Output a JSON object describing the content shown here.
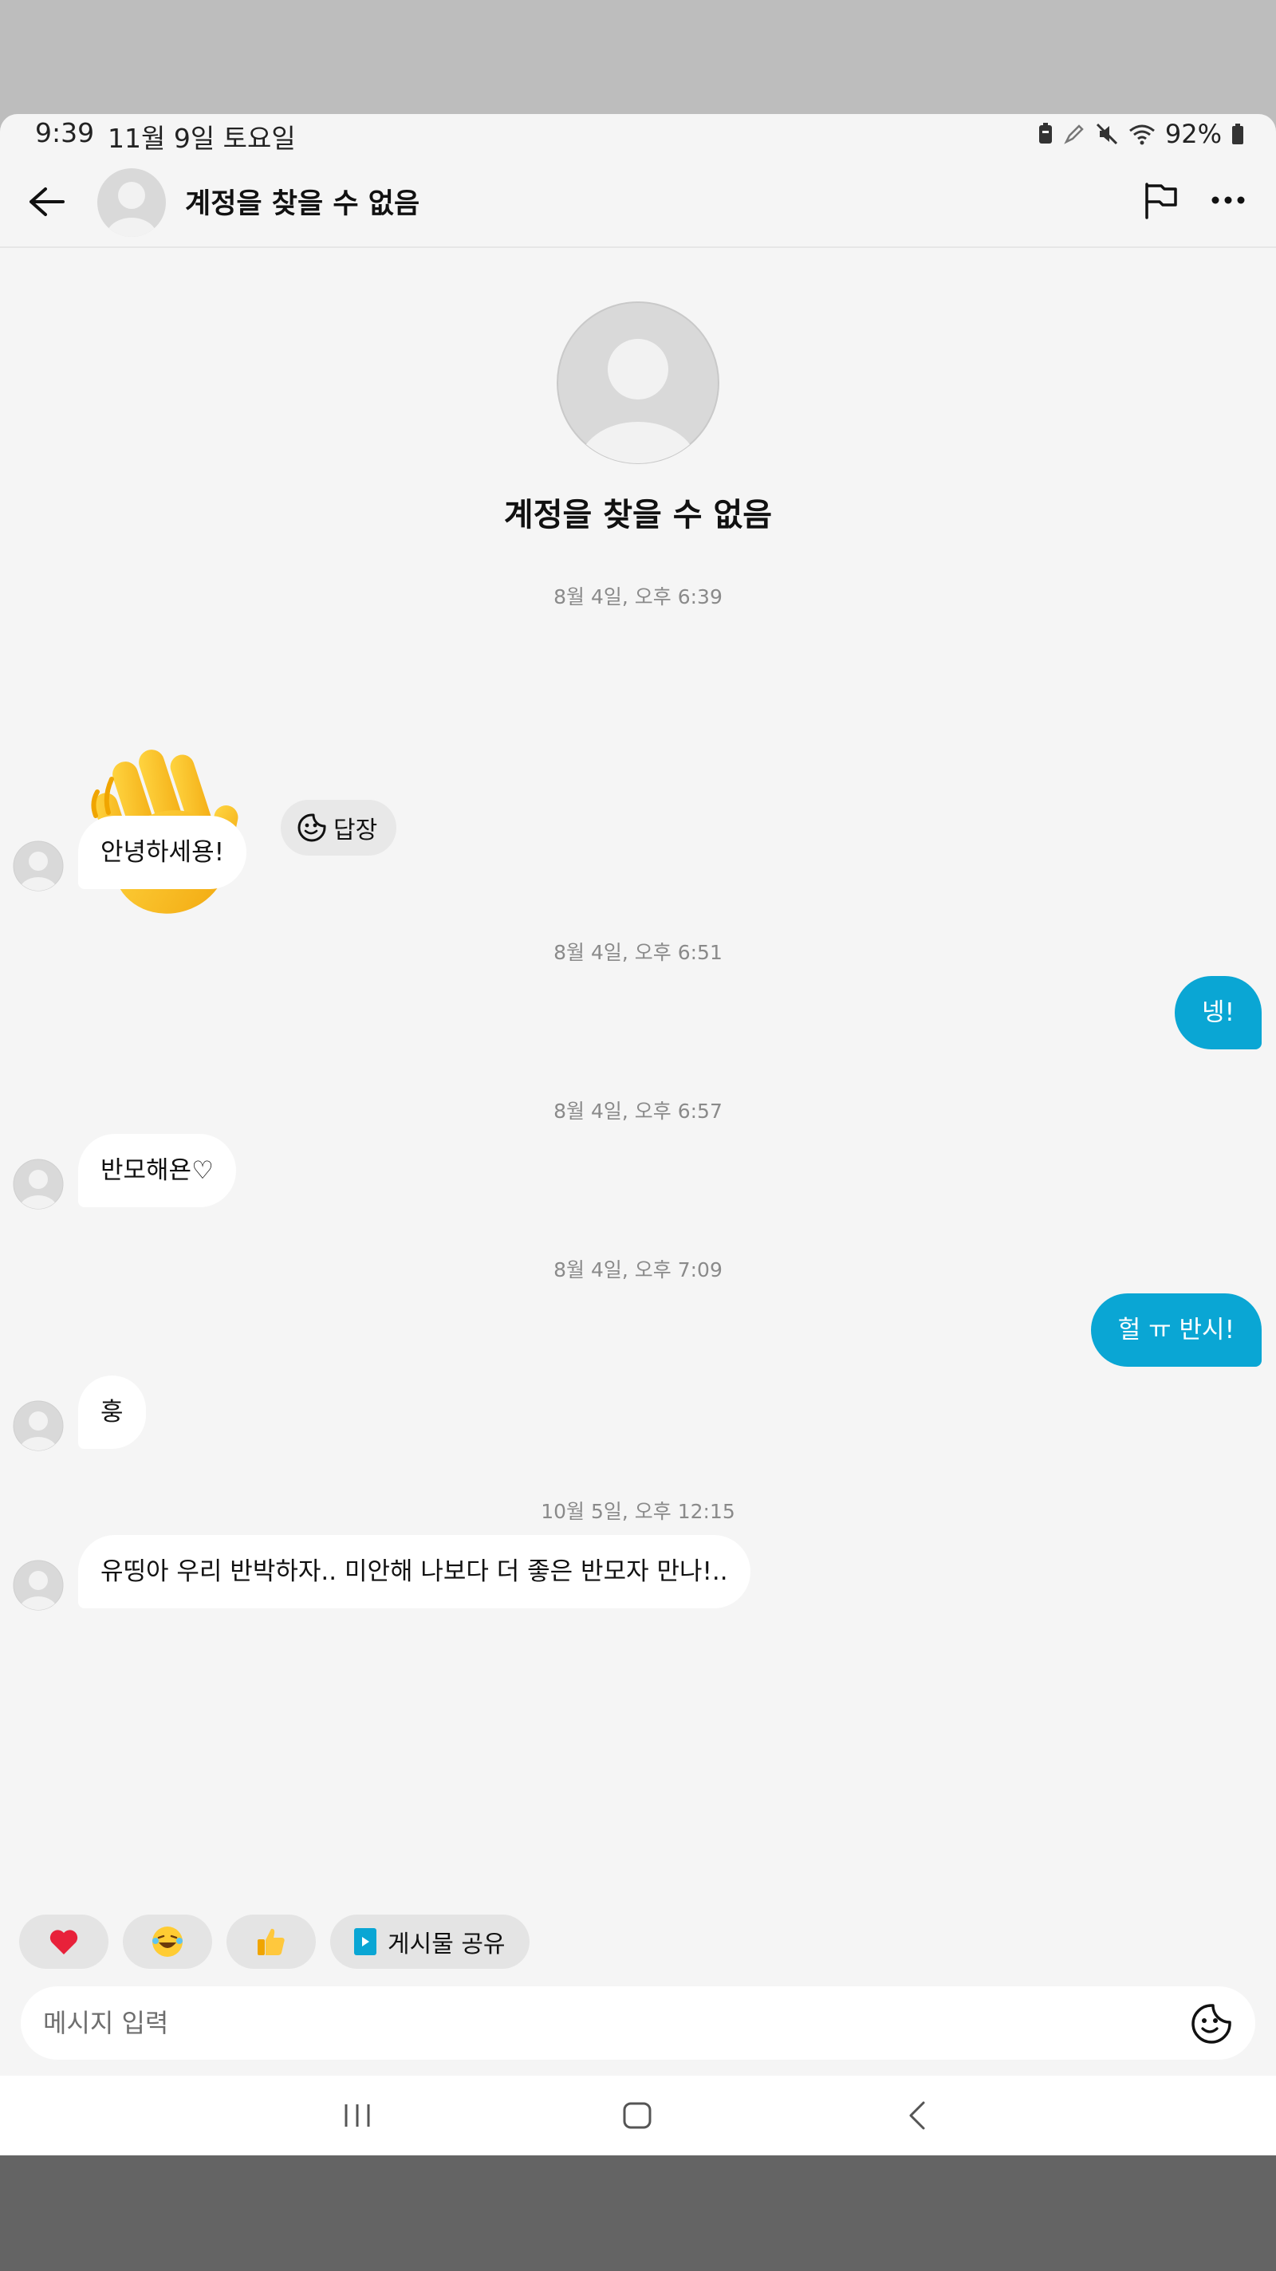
{
  "status_bar": {
    "time": "9:39",
    "date": "11월 9일 토요일",
    "battery": "92%"
  },
  "header": {
    "title": "계정을 찾을 수 없음"
  },
  "profile": {
    "name": "계정을 찾을 수 없음"
  },
  "messages": {
    "ts1": "8월 4일, 오후 6:39",
    "reply_label": "답장",
    "m1": "안녕하세용!",
    "ts2": "8월 4일, 오후 6:51",
    "m2": "넹!",
    "ts3": "8월 4일, 오후 6:57",
    "m3": "반모해욘♡",
    "ts4": "8월 4일, 오후 7:09",
    "m4": "헐 ㅠ 반시!",
    "m5": "훙",
    "ts5": "10월 5일, 오후 12:15",
    "m6": "유띵아 우리 반박하자.. 미안해 나보다 더 좋은 반모자 만나!.."
  },
  "quick_reactions": {
    "heart": "❤️",
    "laugh": "😂",
    "thumbs": "👍",
    "share_label": "게시물 공유"
  },
  "input": {
    "placeholder": "메시지 입력"
  },
  "colors": {
    "accent": "#0aa6d4",
    "background": "#f5f5f5",
    "bubble_in": "#ffffff"
  }
}
